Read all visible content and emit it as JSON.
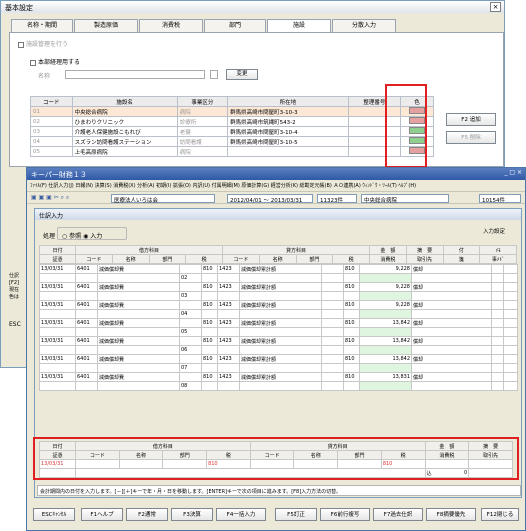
{
  "master": {
    "title": "基本設定",
    "close": "×",
    "tabs": [
      "名称・期間",
      "製造原価",
      "消費税",
      "部門",
      "施設",
      "分散入力"
    ],
    "facility_manage": "施設管理を行う",
    "headoffice": "本部経理用する",
    "name_label": "名称",
    "change_button": "変更",
    "headers": [
      "コード",
      "施設名",
      "事業区分",
      "所在地",
      "整理番号",
      "色"
    ],
    "rows": [
      {
        "code": "01",
        "name": "中央総合病院",
        "div": "病院",
        "addr": "群馬県高崎市問屋町3-10-3",
        "color": "#e6a0a0"
      },
      {
        "code": "02",
        "name": "ひまわりクリニック",
        "div": "診療所",
        "addr": "群馬県高崎市筑縄町543-2",
        "color": "#e6a0a0"
      },
      {
        "code": "03",
        "name": "介護老人保健施設こもれび",
        "div": "老健",
        "addr": "群馬県高崎市問屋町3-10-4",
        "color": "#8fd08f"
      },
      {
        "code": "04",
        "name": "スズラン訪問看護ステーション",
        "div": "訪問看護",
        "addr": "群馬県高崎市問屋町3-10-5",
        "color": "#8fd08f"
      },
      {
        "code": "05",
        "name": "上毛高原病院",
        "div": "病院",
        "addr": "",
        "color": "#e6a0a0"
      }
    ],
    "btn_add": "F2 追加",
    "btn_delete": "F5 削除",
    "left_note": [
      "仕訳",
      "[F2]",
      "現在",
      "色は"
    ],
    "esc": "ESC"
  },
  "keeper": {
    "title": "キーパー財務１３",
    "menu": "ﾌｧｲﾙ(F)  仕訳入力(J)  日報(N)  決算(S)  消費税(X)  分析(A)  初期(I)  拡張(O)  内訳(U)  付属明細(M)  原価計算(G)  経営分析(K)  総勘定元帳(B)  ＡＯ連携(A)  ｳｨﾝﾄﾞｳ・ﾂｰﾙ(T)  ﾍﾙﾌﾟ(H)",
    "corp": "医療法人いろは会",
    "period": "2012/04/01 ～ 2013/03/31",
    "count": "11323件",
    "facility": "中央総合病院",
    "count2": "10154件",
    "subwin_title": "仕訳入力",
    "mode_label": "処理",
    "mode_ref": "参照",
    "mode_input": "入力",
    "settings": "入力設定",
    "grid_head1": [
      "日付",
      "借方科目",
      "貸方科目",
      "金　額",
      "摘　要",
      "付",
      "ﾒﾓ"
    ],
    "grid_head2": [
      "証憑",
      "コード",
      "名称",
      "部門",
      "税",
      "コード",
      "名称",
      "部門",
      "税",
      "消費税",
      "取引先",
      "箋",
      "事ﾒﾄﾞ"
    ],
    "entries": [
      {
        "date": "13/03/31",
        "code": "6401",
        "name": "減価償却費",
        "dept": "",
        "tax": "810",
        "ccode": "1423",
        "cname": "減価償却累計額",
        "ctax": "810",
        "amount": "9,228",
        "memo": "償却",
        "sub": "02"
      },
      {
        "date": "13/03/31",
        "code": "6401",
        "name": "減価償却費",
        "dept": "",
        "tax": "810",
        "ccode": "1423",
        "cname": "減価償却累計額",
        "ctax": "810",
        "amount": "9,228",
        "memo": "償却",
        "sub": "03"
      },
      {
        "date": "13/03/31",
        "code": "6401",
        "name": "減価償却費",
        "dept": "",
        "tax": "810",
        "ccode": "1423",
        "cname": "減価償却累計額",
        "ctax": "810",
        "amount": "9,228",
        "memo": "償却",
        "sub": "04"
      },
      {
        "date": "13/03/31",
        "code": "6401",
        "name": "減価償却費",
        "dept": "",
        "tax": "810",
        "ccode": "1423",
        "cname": "減価償却累計額",
        "ctax": "810",
        "amount": "13,842",
        "memo": "償却",
        "sub": "05"
      },
      {
        "date": "13/03/31",
        "code": "6401",
        "name": "減価償却費",
        "dept": "",
        "tax": "810",
        "ccode": "1423",
        "cname": "減価償却累計額",
        "ctax": "810",
        "amount": "13,842",
        "memo": "償却",
        "sub": "06"
      },
      {
        "date": "13/03/31",
        "code": "6401",
        "name": "減価償却費",
        "dept": "",
        "tax": "810",
        "ccode": "1423",
        "cname": "減価償却累計額",
        "ctax": "810",
        "amount": "13,842",
        "memo": "償却",
        "sub": "07"
      },
      {
        "date": "13/03/31",
        "code": "6401",
        "name": "減価償却費",
        "dept": "",
        "tax": "810",
        "ccode": "1423",
        "cname": "減価償却累計額",
        "ctax": "810",
        "amount": "13,831",
        "memo": "償却",
        "sub": "08"
      }
    ],
    "input_head1": [
      "日付",
      "借方科目",
      "貸方科目",
      "金　額",
      "摘　要"
    ],
    "input_head2": [
      "証憑",
      "コード",
      "名称",
      "部門",
      "税",
      "コード",
      "名称",
      "部門",
      "税",
      "消費税",
      "取引先"
    ],
    "input_date": "13/03/31",
    "input_tax": "810",
    "input_ctax": "810",
    "input_incl": "込",
    "input_zero": "0",
    "status": "会計期間内の日付を入力します。[－][＋]キーで年・月・日を移動します。[ENTER]キーで次の項目に進みます。[F8]入力方法の切替。",
    "fkeys": [
      "ESCｷｬﾝｾﾙ",
      "F1ヘルプ",
      "F2通常",
      "F3決算",
      "F4一括入力",
      "F5訂正",
      "F6前行複写",
      "F7過去仕訳",
      "F8摘要優先",
      "F12閉じる"
    ]
  }
}
